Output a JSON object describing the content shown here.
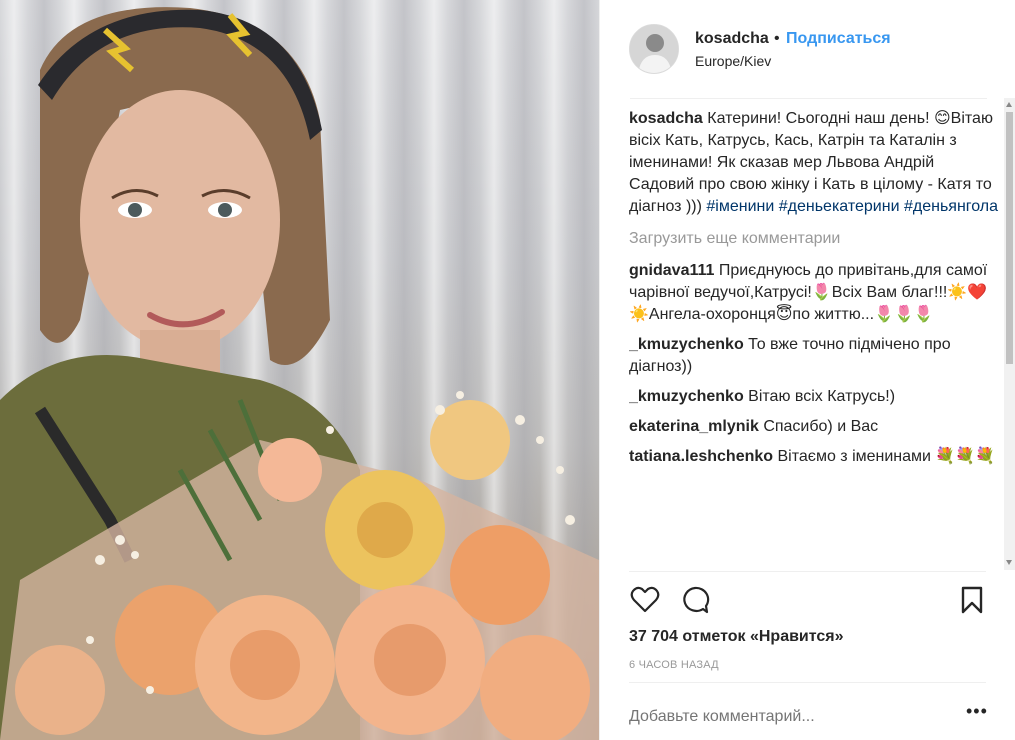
{
  "post": {
    "author": "kosadcha",
    "dot": "•",
    "follow_label": "Подписаться",
    "location": "Europe/Kiev",
    "icons": {
      "like": "heart-icon",
      "comment": "comment-bubble-icon",
      "save": "bookmark-icon",
      "more": "more-options-icon"
    }
  },
  "caption": {
    "user": "kosadcha",
    "text": "Катерини! Сьогодні наш день! 😊Вітаю вісіх Кать, Катрусь, Кась, Катрін та Каталін з іменинами! Як сказав мер Львова Андрій Садовий про свою жінку і Кать в цілому - Катя то діагноз ))) ",
    "tags": [
      "#іменини",
      "#деньекатерини",
      "#деньянгола"
    ]
  },
  "load_more": "Загрузить еще комментарии",
  "comments": [
    {
      "user": "gnidava111",
      "text": "Приєднуюсь до привітань,для самої чарівної ведучої,Катрусі!🌷Всіх Вам благ!!!☀️❤️☀️Ангела-охоронця😇по життю...🌷🌷🌷"
    },
    {
      "user": "_kmuzychenko",
      "text": "То вже точно підмічено про діагноз))"
    },
    {
      "user": "_kmuzychenko",
      "text": "Вітаю всіх Катрусь!)"
    },
    {
      "user": "ekaterina_mlynik",
      "text": "Спасибо) и Вас"
    },
    {
      "user": "tatiana.leshchenko",
      "text": "Вітаємо з іменинами 💐💐💐"
    }
  ],
  "likes": "37 704 отметок «Нравится»",
  "time": "6 ЧАСОВ НАЗАД",
  "add_comment_placeholder": "Добавьте комментарий...",
  "more_dots": "•••",
  "colors": {
    "link_blue": "#3897f0",
    "hashtag": "#003569",
    "muted": "#999999",
    "text": "#262626"
  }
}
